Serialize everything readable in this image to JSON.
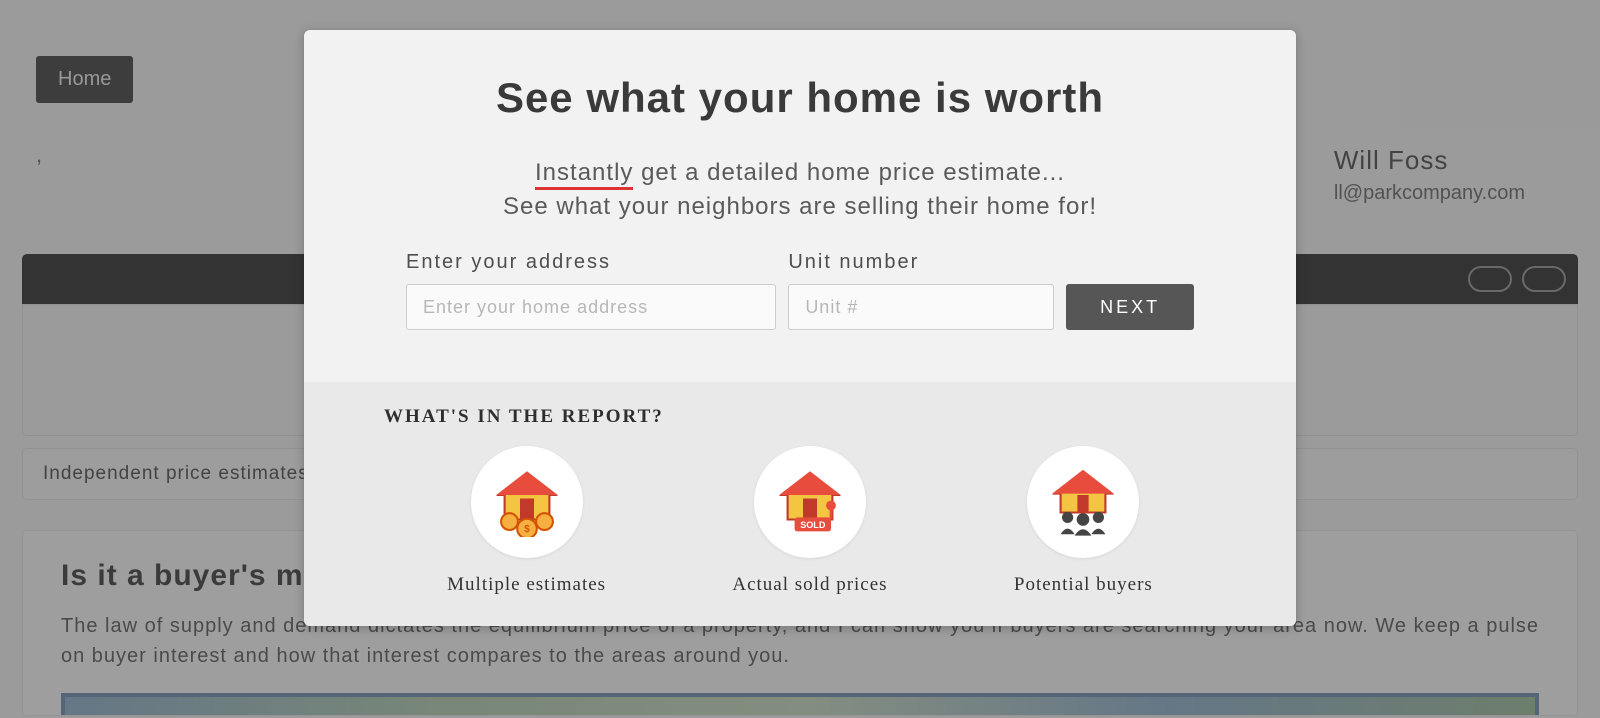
{
  "nav": {
    "home_label": "Home"
  },
  "agent": {
    "name": "Will Foss",
    "email": "ll@parkcompany.com"
  },
  "background": {
    "estimates_text": "Independent price estimates                                                                                                                                                                                                             hey don`t walk through your hom                                                                                                                                                                                                                                   rket.",
    "section2_heading": "Is it a buyer's ma",
    "section2_body": "The law of supply and demand dictates the equilibrium price of a property, and I can show you if buyers are searching your area now. We keep a pulse on buyer interest and how that interest compares to the areas around you."
  },
  "modal": {
    "title": "See what your home is worth",
    "instantly": "Instantly",
    "sub_line1_rest": " get a detailed home price estimate...",
    "sub_line2": "See what your neighbors are selling their home for!",
    "address_label": "Enter your address",
    "address_placeholder": "Enter your home address",
    "unit_label": "Unit number",
    "unit_placeholder": "Unit #",
    "next_label": "NEXT",
    "report_heading": "WHAT'S IN THE REPORT?",
    "features": {
      "f1": "Multiple estimates",
      "f2": "Actual sold prices",
      "f3": "Potential buyers"
    }
  }
}
